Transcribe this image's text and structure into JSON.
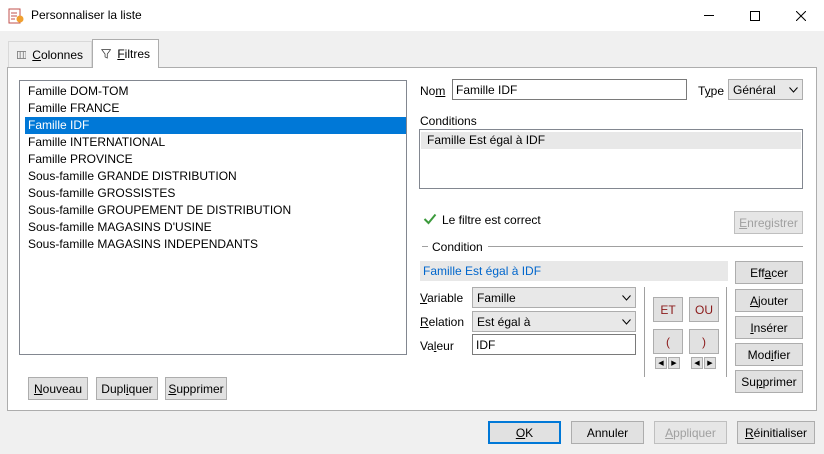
{
  "window": {
    "title": "Personnaliser la liste",
    "minimize_glyph": "—",
    "maximize_glyph": "☐",
    "close_glyph": "✕"
  },
  "tabs": [
    {
      "label": "Colonnes",
      "accel": "C",
      "rest": "olonnes",
      "icon": "columns-icon",
      "selected": false
    },
    {
      "label": "Filtres",
      "accel": "F",
      "rest": "iltres",
      "icon": "filter-icon",
      "selected": true
    }
  ],
  "filter_list": {
    "items": [
      "Famille DOM-TOM",
      "Famille FRANCE",
      "Famille IDF",
      "Famille INTERNATIONAL",
      "Famille PROVINCE",
      "Sous-famille GRANDE DISTRIBUTION",
      "Sous-famille GROSSISTES",
      "Sous-famille GROUPEMENT DE DISTRIBUTION",
      "Sous-famille MAGASINS D'USINE",
      "Sous-famille MAGASINS INDEPENDANTS"
    ],
    "selected_index": 2
  },
  "list_buttons": {
    "new": {
      "accel": "N",
      "rest": "ouveau"
    },
    "duplicate": {
      "pre": "Dupl",
      "accel": "i",
      "rest": "quer"
    },
    "delete": {
      "accel": "S",
      "rest": "upprimer"
    }
  },
  "form": {
    "name_label": {
      "pre": "No",
      "accel": "m",
      "rest": ""
    },
    "name_value": "Famille IDF",
    "type_label": {
      "pre": "T",
      "accel": "y",
      "rest": "pe"
    },
    "type_value": "Général",
    "conditions_label": "Conditions",
    "conditions": [
      "Famille Est égal à IDF"
    ],
    "status_text": "Le filtre est correct",
    "status_color": "#3c9a3c",
    "save_label": {
      "accel": "E",
      "rest": "nregistrer"
    }
  },
  "condition_section": {
    "title": "Condition",
    "current": "Famille Est égal à IDF",
    "current_color": "#0066cc",
    "variable_label": {
      "accel": "V",
      "rest": "ariable"
    },
    "variable_value": "Famille",
    "relation_label": {
      "accel": "R",
      "rest": "elation"
    },
    "relation_value": "Est égal à",
    "value_label": {
      "pre": "Va",
      "accel": "l",
      "rest": "eur"
    },
    "value_value": "IDF",
    "and_label": "ET",
    "or_label": "OU",
    "open_paren": "(",
    "close_paren": ")",
    "operator_color": "#8b1a1a",
    "clear_label": {
      "pre": "Eff",
      "accel": "a",
      "rest": "cer"
    },
    "add_label": {
      "accel": "A",
      "rest": "jouter"
    },
    "insert_label": {
      "accel": "I",
      "rest": "nsérer"
    },
    "modify_label": {
      "pre": "Mod",
      "accel": "i",
      "rest": "fier"
    },
    "delete_label": {
      "pre": "Su",
      "accel": "p",
      "rest": "primer"
    }
  },
  "footer": {
    "ok": {
      "accel": "O",
      "rest": "K"
    },
    "cancel": "Annuler",
    "apply": {
      "accel": "A",
      "rest": "ppliquer"
    },
    "reset": {
      "accel": "R",
      "rest": "éinitialiser"
    }
  }
}
